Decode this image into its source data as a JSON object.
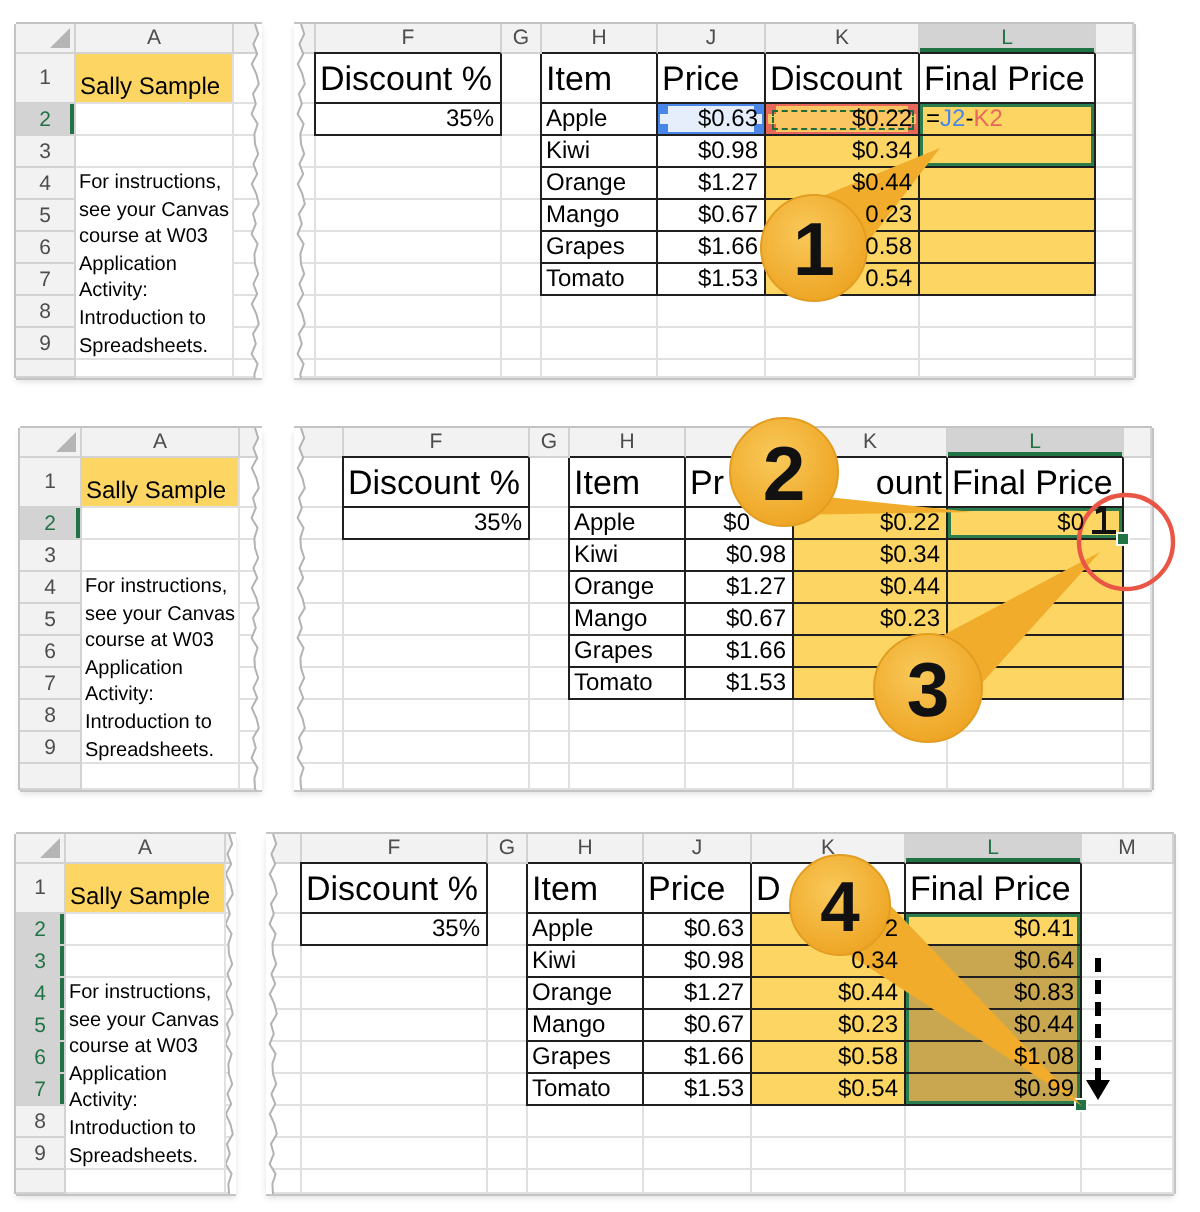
{
  "panels": [
    {
      "left_sheet": {
        "columns": [
          {
            "label": "A",
            "selected": false
          }
        ],
        "rows": [
          {
            "label": "1",
            "selected": false
          },
          {
            "label": "2",
            "selected": true
          },
          {
            "label": "3",
            "selected": false
          },
          {
            "label": "4",
            "selected": false
          },
          {
            "label": "5",
            "selected": false
          },
          {
            "label": "6",
            "selected": false
          },
          {
            "label": "7",
            "selected": false
          },
          {
            "label": "8",
            "selected": false
          },
          {
            "label": "9",
            "selected": false
          }
        ],
        "name_cell": "Sally Sample",
        "instructions": "For instructions, see your Canvas course at W03 Application Activity: Introduction to Spreadsheets."
      },
      "right_sheet": {
        "editing": true,
        "columns": [
          {
            "label": "F",
            "selected": false
          },
          {
            "label": "G",
            "selected": false
          },
          {
            "label": "H",
            "selected": false
          },
          {
            "label": "J",
            "selected": false
          },
          {
            "label": "K",
            "selected": false
          },
          {
            "label": "L",
            "selected": true
          }
        ],
        "discount_label": "Discount %",
        "discount_rate": "35%",
        "headers": [
          "Item",
          "Price",
          "Discount",
          "Final Price"
        ],
        "rows": [
          {
            "item": "Apple",
            "price": {
              "text": "$0.63",
              "color": "#4a86e8",
              "marquee": false
            },
            "discount": {
              "text": "$0.22",
              "color": "#e8675b",
              "marquee": true
            },
            "final_price": {
              "formula": [
                {
                  "text": "="
                },
                {
                  "text": "J2",
                  "color": "#4a86e8"
                },
                {
                  "text": "-"
                },
                {
                  "text": "K2",
                  "color": "#e8675b"
                }
              ],
              "selected": true
            }
          },
          {
            "item": "Kiwi",
            "price": "$0.98",
            "discount": "$0.34",
            "final_price": {
              "selected": true
            }
          },
          {
            "item": "Orange",
            "price": "$1.27",
            "discount": "$0.44",
            "final_price": {
              "selected": false
            }
          },
          {
            "item": "Mango",
            "price": "$0.67",
            "discount": "0.23",
            "final_price": {
              "selected": false
            }
          },
          {
            "item": "Grapes",
            "price": "$1.66",
            "discount": "0.58",
            "final_price": {
              "selected": false
            }
          },
          {
            "item": "Tomato",
            "price": "$1.53",
            "discount": "0.54",
            "final_price": {
              "selected": false
            }
          }
        ]
      },
      "annotations": [
        {
          "kind": "callout",
          "number": "1"
        }
      ]
    },
    {
      "left_sheet": {
        "columns": [
          {
            "label": "A",
            "selected": false
          }
        ],
        "rows": [
          {
            "label": "1",
            "selected": false
          },
          {
            "label": "2",
            "selected": true
          },
          {
            "label": "3",
            "selected": false
          },
          {
            "label": "4",
            "selected": false
          },
          {
            "label": "5",
            "selected": false
          },
          {
            "label": "6",
            "selected": false
          },
          {
            "label": "7",
            "selected": false
          },
          {
            "label": "8",
            "selected": false
          },
          {
            "label": "9",
            "selected": false
          }
        ],
        "name_cell": "Sally Sample",
        "instructions": "For instructions, see your Canvas course at W03 Application Activity: Introduction to Spreadsheets."
      },
      "right_sheet": {
        "editing": false,
        "columns": [
          {
            "label": "F",
            "selected": false
          },
          {
            "label": "G",
            "selected": false
          },
          {
            "label": "H",
            "selected": false
          },
          {
            "label": "K",
            "selected": false
          },
          {
            "label": "L",
            "selected": true
          }
        ],
        "discount_label": "Discount %",
        "discount_rate": "35%",
        "headers": [
          "Item",
          "Pr",
          "ount",
          "Final Price"
        ],
        "rows": [
          {
            "item": "Apple",
            "price": "$0",
            "discount": "$0.22",
            "final_price": {
              "text": "$0",
              "selected": true
            }
          },
          {
            "item": "Kiwi",
            "price": "$0.98",
            "discount": "$0.34",
            "final_price": {
              "selected": false
            }
          },
          {
            "item": "Orange",
            "price": "$1.27",
            "discount": "$0.44",
            "final_price": {
              "selected": false
            }
          },
          {
            "item": "Mango",
            "price": "$0.67",
            "discount": "$0.23",
            "final_price": {
              "selected": false
            }
          },
          {
            "item": "Grapes",
            "price": "$1.66",
            "final_price": {
              "selected": false
            }
          },
          {
            "item": "Tomato",
            "price": "$1.53",
            "final_price": {
              "selected": false
            }
          }
        ]
      },
      "annotations": [
        {
          "kind": "callout",
          "number": "2"
        },
        {
          "kind": "callout",
          "number": "3"
        },
        {
          "kind": "ring"
        },
        {
          "kind": "cursor"
        }
      ]
    },
    {
      "left_sheet": {
        "columns": [
          {
            "label": "A",
            "selected": false
          }
        ],
        "rows": [
          {
            "label": "1",
            "selected": false
          },
          {
            "label": "2",
            "selected": true
          },
          {
            "label": "3",
            "selected": true
          },
          {
            "label": "4",
            "selected": true
          },
          {
            "label": "5",
            "selected": true
          },
          {
            "label": "6",
            "selected": true
          },
          {
            "label": "7",
            "selected": true
          },
          {
            "label": "8",
            "selected": false
          },
          {
            "label": "9",
            "selected": false
          }
        ],
        "name_cell": "Sally Sample",
        "instructions": "For instructions, see your Canvas course at W03 Application Activity: Introduction to Spreadsheets."
      },
      "right_sheet": {
        "editing": false,
        "columns": [
          {
            "label": "F",
            "selected": false
          },
          {
            "label": "G",
            "selected": false
          },
          {
            "label": "H",
            "selected": false
          },
          {
            "label": "J",
            "selected": false
          },
          {
            "label": "K",
            "selected": false
          },
          {
            "label": "L",
            "selected": true
          },
          {
            "label": "M",
            "selected": false
          }
        ],
        "discount_label": "Discount %",
        "discount_rate": "35%",
        "headers": [
          "Item",
          "Price",
          "D",
          "Final Price"
        ],
        "rows": [
          {
            "item": "Apple",
            "price": "$0.63",
            "discount": "2",
            "final_price": {
              "text": "$0.41",
              "selected": true
            }
          },
          {
            "item": "Kiwi",
            "price": "$0.98",
            "discount": "0.34",
            "final_price": {
              "text": "$0.64",
              "selected": true
            }
          },
          {
            "item": "Orange",
            "price": "$1.27",
            "discount": "$0.44",
            "final_price": {
              "text": "$0.83",
              "selected": true
            }
          },
          {
            "item": "Mango",
            "price": "$0.67",
            "discount": "$0.23",
            "final_price": {
              "text": "$0.44",
              "selected": true
            }
          },
          {
            "item": "Grapes",
            "price": "$1.66",
            "discount": "$0.58",
            "final_price": {
              "text": "$1.08",
              "selected": true
            }
          },
          {
            "item": "Tomato",
            "price": "$1.53",
            "discount": "$0.54",
            "final_price": {
              "text": "$0.99",
              "selected": true
            }
          }
        ]
      },
      "annotations": [
        {
          "kind": "callout",
          "number": "4"
        },
        {
          "kind": "arrow"
        }
      ]
    }
  ]
}
